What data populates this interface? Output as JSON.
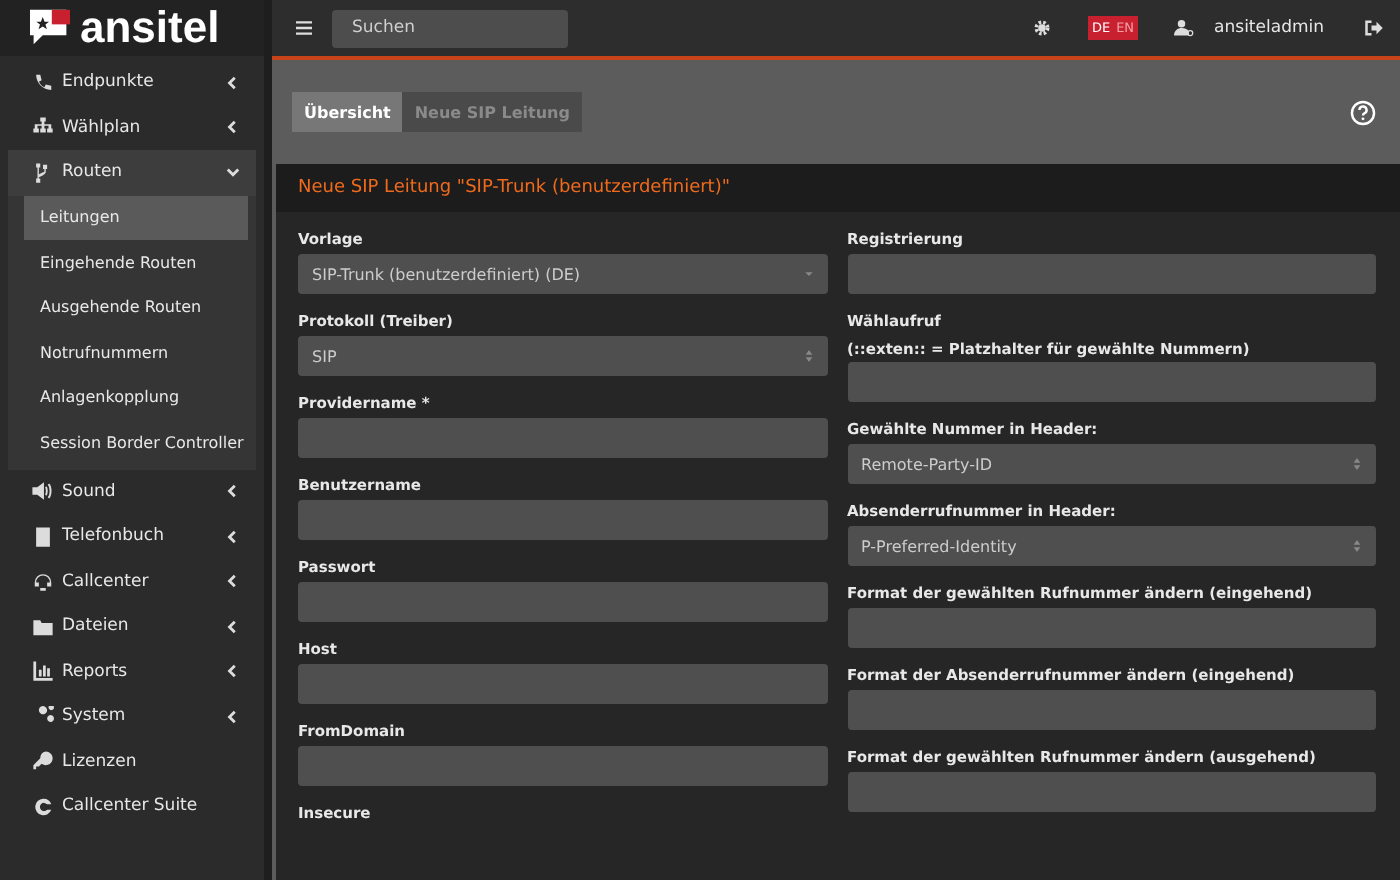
{
  "brand": {
    "name": "ansitel"
  },
  "header": {
    "search": {
      "placeholder": "Suchen"
    },
    "languages": [
      {
        "label": "DE",
        "selected": true
      },
      {
        "label": "EN",
        "selected": false
      }
    ],
    "user": "ansiteladmin"
  },
  "sidebar": {
    "items": [
      {
        "label": "Endpunkte",
        "kind": "menu",
        "selected": false,
        "expanded": false
      },
      {
        "label": "Wählplan",
        "kind": "menu",
        "selected": false,
        "expanded": false
      },
      {
        "label": "Routen",
        "kind": "menu",
        "selected": true,
        "expanded": true,
        "children": [
          {
            "label": "Leitungen",
            "selected": true
          },
          {
            "label": "Eingehende Routen",
            "selected": false
          },
          {
            "label": "Ausgehende Routen",
            "selected": false
          },
          {
            "label": "Notrufnummern",
            "selected": false
          },
          {
            "label": "Anlagenkopplung",
            "selected": false
          },
          {
            "label": "Session Border Controller",
            "selected": false
          }
        ]
      },
      {
        "label": "Sound",
        "kind": "menu",
        "selected": false,
        "expanded": false
      },
      {
        "label": "Telefonbuch",
        "kind": "menu",
        "selected": false,
        "expanded": false
      },
      {
        "label": "Callcenter",
        "kind": "menu",
        "selected": false,
        "expanded": false
      },
      {
        "label": "Dateien",
        "kind": "menu",
        "selected": false,
        "expanded": false
      },
      {
        "label": "Reports",
        "kind": "menu",
        "selected": false,
        "expanded": false
      },
      {
        "label": "System",
        "kind": "menu",
        "selected": false,
        "expanded": false
      },
      {
        "label": "Lizenzen",
        "kind": "link",
        "selected": false
      },
      {
        "label": "Callcenter Suite",
        "kind": "link",
        "selected": false
      }
    ]
  },
  "tabs": [
    {
      "label": "Übersicht",
      "selected": true
    },
    {
      "label": "Neue SIP Leitung",
      "selected": false
    }
  ],
  "panel": {
    "title": "Neue SIP Leitung \"SIP-Trunk (benutzerdefiniert)\"",
    "left_fields": [
      {
        "label": "Vorlage",
        "kind": "dropdown",
        "value": "SIP-Trunk (benutzerdefiniert) (DE)"
      },
      {
        "label": "Protokoll (Treiber)",
        "kind": "select",
        "value": "SIP"
      },
      {
        "label": "Providername *",
        "kind": "input"
      },
      {
        "label": "Benutzername",
        "kind": "input"
      },
      {
        "label": "Passwort",
        "kind": "input"
      },
      {
        "label": "Host",
        "kind": "input"
      },
      {
        "label": "FromDomain",
        "kind": "input"
      },
      {
        "label": "Insecure",
        "kind": "label"
      }
    ],
    "right_fields": [
      {
        "label": "Registrierung",
        "kind": "input"
      },
      {
        "label": "Wählaufruf",
        "hint": "(::exten:: = Platzhalter für gewählte Nummern)",
        "kind": "input"
      },
      {
        "label": "Gewählte Nummer in Header:",
        "kind": "select",
        "value": "Remote-Party-ID"
      },
      {
        "label": "Absenderrufnummer in Header:",
        "kind": "select",
        "value": "P-Preferred-Identity"
      },
      {
        "label": "Format der gewählten Rufnummer ändern (eingehend)",
        "kind": "input"
      },
      {
        "label": "Format der Absenderrufnummer ändern (eingehend)",
        "kind": "input"
      },
      {
        "label": "Format der gewählten Rufnummer ändern (ausgehend)",
        "kind": "input"
      }
    ]
  }
}
